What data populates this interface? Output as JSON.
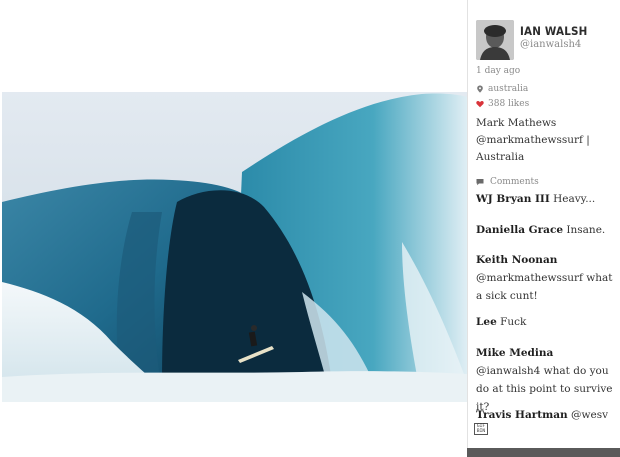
{
  "post": {
    "image_alt": "surfer riding inside a massive barrel wave",
    "time_ago": "1 day ago",
    "location": "australia",
    "likes": "388 likes",
    "caption": "Mark Mathews @markmathewssurf | Australia"
  },
  "user": {
    "name": "IAN WALSH",
    "handle": "@ianwalsh4"
  },
  "comments": {
    "label": "Comments",
    "items": [
      {
        "author": "WJ Bryan III",
        "text": " Heavy..."
      },
      {
        "author": "Daniella Grace",
        "text": " Insane."
      },
      {
        "author": "Keith Noonan",
        "text": " @markmathewssurf what a sick cunt!"
      },
      {
        "author": "Lee",
        "text": " Fuck"
      },
      {
        "author": "Mike Medina",
        "text": " @ianwalsh4 what do you do at this point to survive it?"
      },
      {
        "author": "Travis Hartman",
        "text": " @wesv"
      }
    ]
  },
  "badge": {
    "text": "GIF BIN"
  },
  "icons": {
    "location": "location-pin-icon",
    "likes": "heart-icon",
    "comments": "comment-bubble-icon"
  },
  "colors": {
    "heart": "#d9343a",
    "muted": "#8a8a8a"
  }
}
